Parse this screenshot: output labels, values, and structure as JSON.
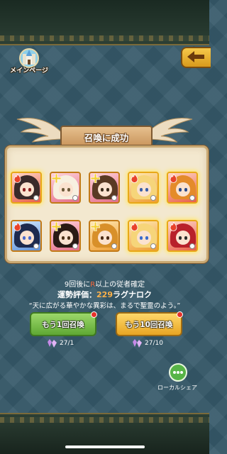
{
  "header": {
    "main_page_label": "メインページ"
  },
  "result": {
    "title": "召喚に成功"
  },
  "cards": [
    {
      "element": "fire",
      "bg": "red",
      "hair": "#3a2a2a",
      "eye": "#8a1f1f",
      "glow": true
    },
    {
      "element": "light",
      "bg": "pink",
      "hair": "#f7f0e0",
      "eye": "#6d5a3a",
      "glow": false
    },
    {
      "element": "light",
      "bg": "pink",
      "hair": "#5a3a24",
      "eye": "#3a2a1a",
      "glow": false
    },
    {
      "element": "fire",
      "bg": "orange",
      "hair": "#f6d57a",
      "eye": "#3a5fa8",
      "glow": true
    },
    {
      "element": "fire",
      "bg": "red",
      "hair": "#e48b2a",
      "eye": "#2a4a8a",
      "glow": true
    },
    {
      "element": "fire",
      "bg": "blue",
      "hair": "#1d2a4e",
      "eye": "#4a6acc",
      "glow": false
    },
    {
      "element": "light",
      "bg": "pink",
      "hair": "#2a1a14",
      "eye": "#4a3018",
      "glow": false
    },
    {
      "element": "light",
      "bg": "orange",
      "hair": "#d8902a",
      "eye": "#4a2a14",
      "glow": false
    },
    {
      "element": "fire",
      "bg": "orange",
      "hair": "#f6d57a",
      "eye": "#3a6acc",
      "glow": true
    },
    {
      "element": "fire",
      "bg": "red",
      "hair": "#b8202a",
      "eye": "#2a2a2a",
      "glow": true
    }
  ],
  "pity": {
    "prefix": "9回後に",
    "rarity": "R",
    "suffix": "以上の従者確定"
  },
  "luck": {
    "label": "運勢評価：",
    "value": "229",
    "name": "ラグナロク"
  },
  "fortune_quote": "“天に広がる華やかな異彩は、まるで聖霊のよう。”",
  "buttons": {
    "summon_once": "もう1回召喚",
    "summon_ten": "もう10回召喚"
  },
  "costs": {
    "once": "27/1",
    "ten": "27/10"
  },
  "local_share_label": "ローカルシェア",
  "colors": {
    "fire": "#e8422a",
    "light": "#f3cf34",
    "gold_glow": "#ffe773",
    "accent_orange": "#ff6a3a"
  },
  "icons": {
    "main_page": "castle-icon",
    "back": "back-arrow-icon",
    "cost": "crystal-icon",
    "share": "chat-bubble-icon",
    "fire": "flame-icon",
    "light": "cross-icon"
  }
}
